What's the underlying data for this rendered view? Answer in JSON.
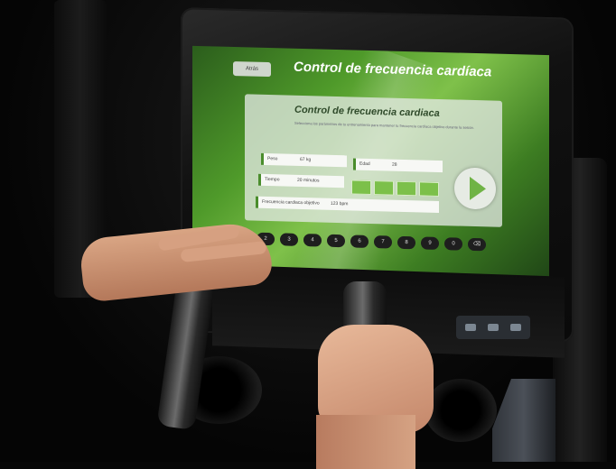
{
  "screen": {
    "back_label": "Atrás",
    "title": "Control de frecuencia cardíaca"
  },
  "panel": {
    "title": "Control de frecuencia cardiaca",
    "description": "Selecciona los parámetros de tu entrenamiento para mantener tu frecuencia cardíaca objetivo durante la sesión."
  },
  "fields": {
    "peso_label": "Peso",
    "peso_value": "67 kg",
    "edad_label": "Edad",
    "edad_value": "28",
    "tiempo_label": "Tiempo",
    "tiempo_value": "20 minutos",
    "fc_label": "Frecuencia cardiaca objetivo",
    "fc_value": "123 bpm"
  },
  "keypad": [
    "1",
    "2",
    "3",
    "4",
    "5",
    "6",
    "7",
    "8",
    "9",
    "0",
    "⌫"
  ],
  "colors": {
    "accent": "#6fb345",
    "screen_bg": "#4f9a2a"
  }
}
